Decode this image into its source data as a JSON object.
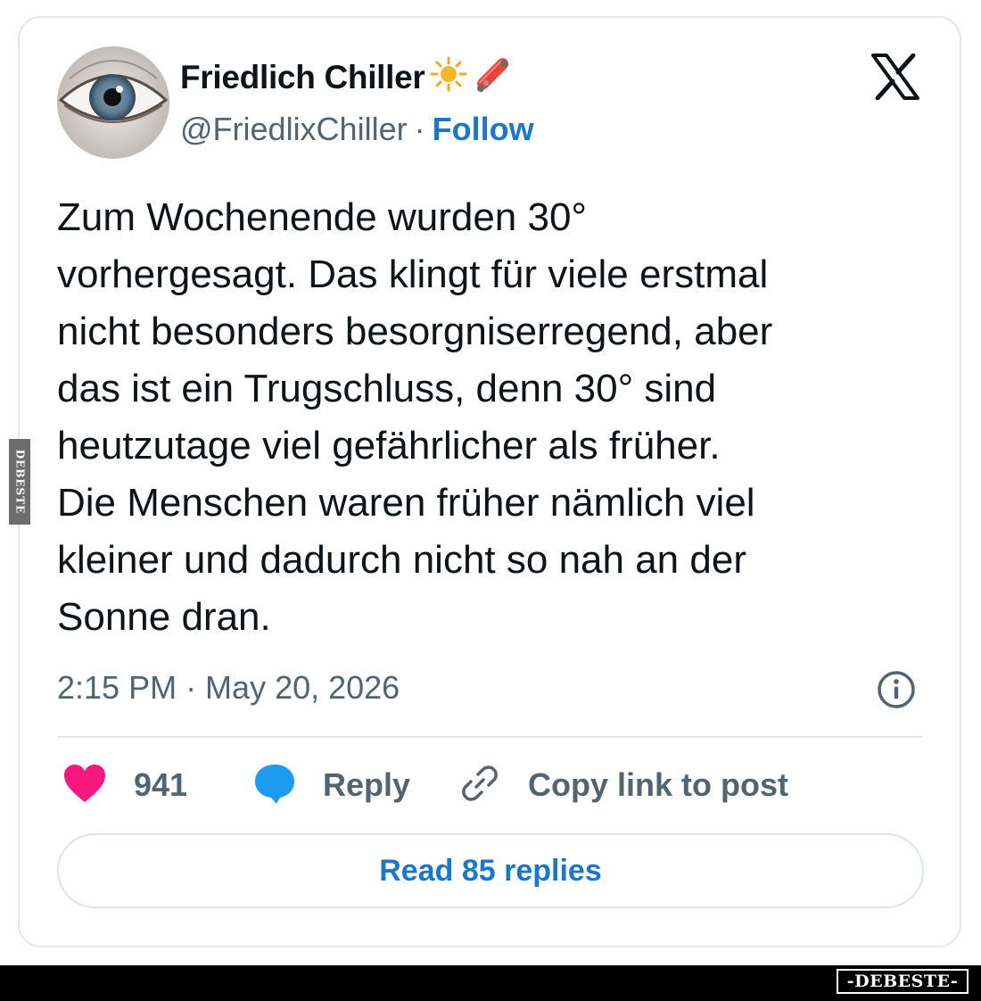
{
  "author": {
    "display_name": "Friedlich Chiller",
    "name_emojis": [
      "sun-icon",
      "skateboard-icon"
    ],
    "handle": "@FriedlixChiller",
    "separator": "·",
    "follow_label": "Follow"
  },
  "tweet": {
    "lines": [
      "Zum Wochenende wurden 30°",
      "vorhergesagt. Das klingt für viele erstmal",
      "nicht besonders besorgniserregend, aber",
      "das ist ein Trugschluss, denn 30° sind",
      "heutzutage viel gefährlicher als früher.",
      "Die Menschen waren früher nämlich viel",
      "kleiner und dadurch nicht so nah an der",
      "Sonne dran."
    ],
    "timestamp": "2:15 PM · May 20, 2026"
  },
  "actions": {
    "like_count": "941",
    "reply_label": "Reply",
    "copy_link_label": "Copy link to post"
  },
  "read_replies_label": "Read 85 replies",
  "watermark": {
    "side": "DEBESTE",
    "bottom": "-DEBESTE-"
  },
  "colors": {
    "link_blue": "#1d76c8",
    "heart_pink": "#f91880",
    "reply_blue": "#1d9bf0",
    "muted_text": "#536471"
  }
}
